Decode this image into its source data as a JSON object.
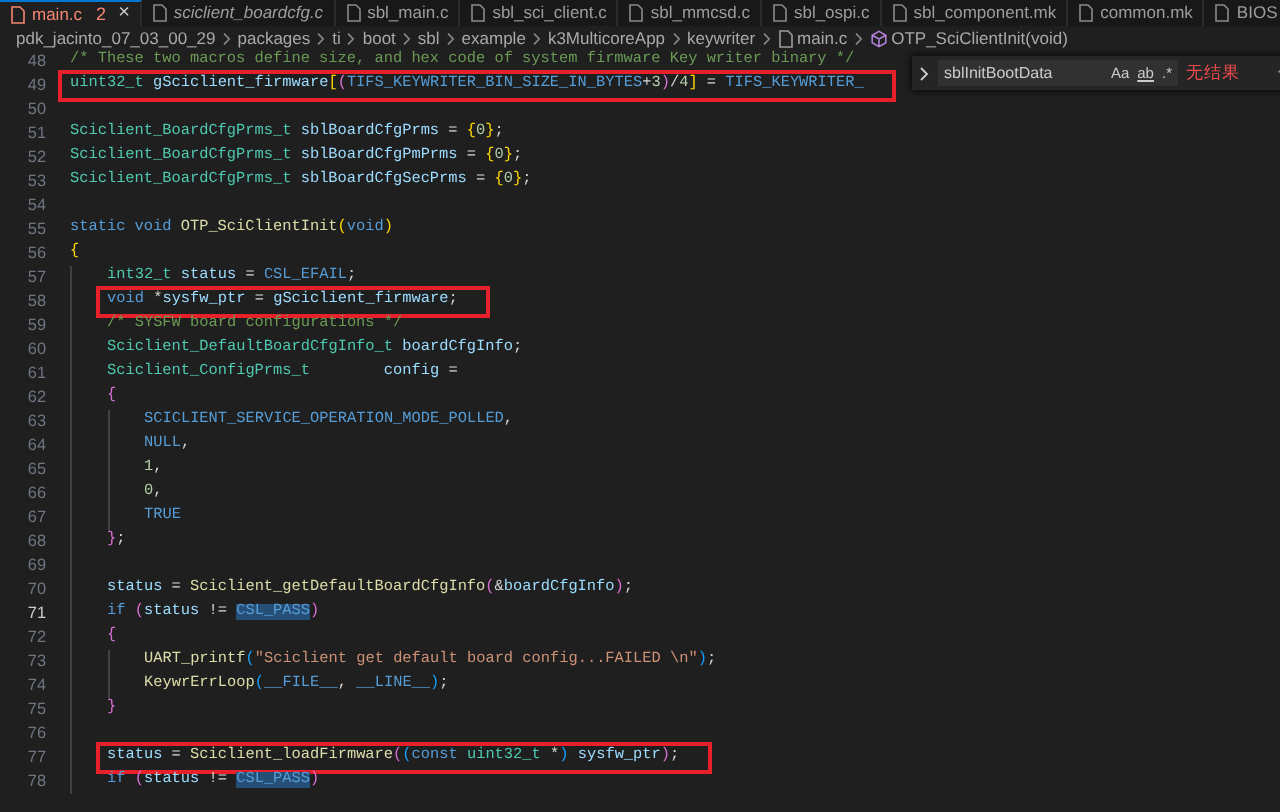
{
  "tabs": [
    {
      "label": "main.c",
      "badge": "2",
      "close": "×",
      "selected": true,
      "preview": false
    },
    {
      "label": "sciclient_boardcfg.c",
      "selected": false,
      "preview": true
    },
    {
      "label": "sbl_main.c",
      "selected": false,
      "preview": false
    },
    {
      "label": "sbl_sci_client.c",
      "selected": false,
      "preview": false
    },
    {
      "label": "sbl_mmcsd.c",
      "selected": false,
      "preview": false
    },
    {
      "label": "sbl_ospi.c",
      "selected": false,
      "preview": false
    },
    {
      "label": "sbl_component.mk",
      "selected": false,
      "preview": false
    },
    {
      "label": "common.mk",
      "selected": false,
      "preview": false
    },
    {
      "label": "BIOS",
      "selected": false,
      "preview": false
    }
  ],
  "breadcrumb": [
    {
      "label": "pdk_jacinto_07_03_00_29",
      "kind": "folder"
    },
    {
      "label": "packages",
      "kind": "folder"
    },
    {
      "label": "ti",
      "kind": "folder"
    },
    {
      "label": "boot",
      "kind": "folder"
    },
    {
      "label": "sbl",
      "kind": "folder"
    },
    {
      "label": "example",
      "kind": "folder"
    },
    {
      "label": "k3MulticoreApp",
      "kind": "folder"
    },
    {
      "label": "keywriter",
      "kind": "folder"
    },
    {
      "label": "main.c",
      "kind": "file"
    },
    {
      "label": "OTP_SciClientInit(void)",
      "kind": "function"
    }
  ],
  "find_widget": {
    "value": "sblInitBootData",
    "options": [
      "Aa",
      "ab",
      ".*"
    ],
    "result": "无结果"
  },
  "code": [
    {
      "number": "48",
      "tokens": [
        {
          "text": "/* These two macros define size, and hex code of system firmware Key writer binary */",
          "kind": "comment"
        }
      ]
    },
    {
      "number": "49",
      "boxed": true,
      "tokens": [
        {
          "text": "uint32_t ",
          "kind": "type"
        },
        {
          "text": "gSciclient_firmware",
          "kind": "var"
        },
        {
          "text": "[",
          "kind": "bracket1"
        },
        {
          "text": "(",
          "kind": "bracket2"
        },
        {
          "text": "TIFS_KEYWRITER_BIN_SIZE_IN_BYTES",
          "kind": "macro"
        },
        {
          "text": "+",
          "kind": "plain"
        },
        {
          "text": "3",
          "kind": "number"
        },
        {
          "text": ")",
          "kind": "bracket2"
        },
        {
          "text": "/",
          "kind": "plain"
        },
        {
          "text": "4",
          "kind": "number"
        },
        {
          "text": "]",
          "kind": "bracket1"
        },
        {
          "text": " = ",
          "kind": "plain"
        },
        {
          "text": "TIFS_KEYWRITER_",
          "kind": "macro"
        }
      ]
    },
    {
      "number": "50"
    },
    {
      "number": "51",
      "tokens": [
        {
          "text": "Sciclient_BoardCfgPrms_t ",
          "kind": "type"
        },
        {
          "text": "sblBoardCfgPrms",
          "kind": "var"
        },
        {
          "text": " = ",
          "kind": "plain"
        },
        {
          "text": "{",
          "kind": "bracket1"
        },
        {
          "text": "0",
          "kind": "number"
        },
        {
          "text": "}",
          "kind": "bracket1"
        },
        {
          "text": ";",
          "kind": "plain"
        }
      ]
    },
    {
      "number": "52",
      "tokens": [
        {
          "text": "Sciclient_BoardCfgPrms_t ",
          "kind": "type"
        },
        {
          "text": "sblBoardCfgPmPrms",
          "kind": "var"
        },
        {
          "text": " = ",
          "kind": "plain"
        },
        {
          "text": "{",
          "kind": "bracket1"
        },
        {
          "text": "0",
          "kind": "number"
        },
        {
          "text": "}",
          "kind": "bracket1"
        },
        {
          "text": ";",
          "kind": "plain"
        }
      ]
    },
    {
      "number": "53",
      "tokens": [
        {
          "text": "Sciclient_BoardCfgPrms_t ",
          "kind": "type"
        },
        {
          "text": "sblBoardCfgSecPrms",
          "kind": "var"
        },
        {
          "text": " = ",
          "kind": "plain"
        },
        {
          "text": "{",
          "kind": "bracket1"
        },
        {
          "text": "0",
          "kind": "number"
        },
        {
          "text": "}",
          "kind": "bracket1"
        },
        {
          "text": ";",
          "kind": "plain"
        }
      ]
    },
    {
      "number": "54"
    },
    {
      "number": "55",
      "tokens": [
        {
          "text": "static void ",
          "kind": "keyword"
        },
        {
          "text": "OTP_SciClientInit",
          "kind": "func"
        },
        {
          "text": "(",
          "kind": "bracket1"
        },
        {
          "text": "void",
          "kind": "keyword"
        },
        {
          "text": ")",
          "kind": "bracket1"
        }
      ]
    },
    {
      "number": "56",
      "tokens": [
        {
          "text": "{",
          "kind": "bracket1"
        }
      ],
      "children": [
        {
          "number": "57",
          "tokens": [
            {
              "text": "int32_t ",
              "kind": "type"
            },
            {
              "text": "status",
              "kind": "var"
            },
            {
              "text": " = ",
              "kind": "plain"
            },
            {
              "text": "CSL_EFAIL",
              "kind": "macro"
            },
            {
              "text": ";",
              "kind": "plain"
            }
          ]
        },
        {
          "number": "58",
          "boxed": true,
          "tokens": [
            {
              "text": "void ",
              "kind": "keyword"
            },
            {
              "text": "*",
              "kind": "plain"
            },
            {
              "text": "sysfw_ptr",
              "kind": "var"
            },
            {
              "text": " = ",
              "kind": "plain"
            },
            {
              "text": "gSciclient_firmware",
              "kind": "var"
            },
            {
              "text": ";",
              "kind": "plain"
            }
          ]
        },
        {
          "number": "59",
          "tokens": [
            {
              "text": "/* SYSFW board configurations */",
              "kind": "comment"
            }
          ]
        },
        {
          "number": "60",
          "tokens": [
            {
              "text": "Sciclient_DefaultBoardCfgInfo_t ",
              "kind": "type"
            },
            {
              "text": "boardCfgInfo",
              "kind": "var"
            },
            {
              "text": ";",
              "kind": "plain"
            }
          ]
        },
        {
          "number": "61",
          "tokens": [
            {
              "text": "Sciclient_ConfigPrms_t        ",
              "kind": "type"
            },
            {
              "text": "config",
              "kind": "var"
            },
            {
              "text": " =",
              "kind": "plain"
            }
          ]
        },
        {
          "number": "62",
          "tokens": [
            {
              "text": "{",
              "kind": "bracket2"
            }
          ],
          "children": [
            {
              "number": "63",
              "tokens": [
                {
                  "text": "SCICLIENT_SERVICE_OPERATION_MODE_POLLED",
                  "kind": "macro"
                },
                {
                  "text": ",",
                  "kind": "plain"
                }
              ]
            },
            {
              "number": "64",
              "tokens": [
                {
                  "text": "NULL",
                  "kind": "macro"
                },
                {
                  "text": ",",
                  "kind": "plain"
                }
              ]
            },
            {
              "number": "65",
              "tokens": [
                {
                  "text": "1",
                  "kind": "number"
                },
                {
                  "text": ",",
                  "kind": "plain"
                }
              ]
            },
            {
              "number": "66",
              "tokens": [
                {
                  "text": "0",
                  "kind": "number"
                },
                {
                  "text": ",",
                  "kind": "plain"
                }
              ]
            },
            {
              "number": "67",
              "tokens": [
                {
                  "text": "TRUE",
                  "kind": "macro"
                }
              ]
            }
          ]
        },
        {
          "number": "68",
          "tokens": [
            {
              "text": "}",
              "kind": "bracket2"
            },
            {
              "text": ";",
              "kind": "plain"
            }
          ]
        },
        {
          "number": "69"
        },
        {
          "number": "70",
          "tokens": [
            {
              "text": "status",
              "kind": "var"
            },
            {
              "text": " = ",
              "kind": "plain"
            },
            {
              "text": "Sciclient_getDefaultBoardCfgInfo",
              "kind": "func"
            },
            {
              "text": "(",
              "kind": "bracket2"
            },
            {
              "text": "&",
              "kind": "plain"
            },
            {
              "text": "boardCfgInfo",
              "kind": "var"
            },
            {
              "text": ")",
              "kind": "bracket2"
            },
            {
              "text": ";",
              "kind": "plain"
            }
          ]
        },
        {
          "number": "71",
          "current": true,
          "tokens": [
            {
              "text": "if ",
              "kind": "keyword"
            },
            {
              "text": "(",
              "kind": "bracket2"
            },
            {
              "text": "status",
              "kind": "var"
            },
            {
              "text": " != ",
              "kind": "plain"
            },
            {
              "text": "CSL_PASS",
              "kind": "match"
            },
            {
              "text": ")",
              "kind": "bracket2"
            }
          ]
        },
        {
          "number": "72",
          "tokens": [
            {
              "text": "{",
              "kind": "bracket2"
            }
          ],
          "children": [
            {
              "number": "73",
              "tokens": [
                {
                  "text": "UART_printf",
                  "kind": "func"
                },
                {
                  "text": "(",
                  "kind": "bracket3"
                },
                {
                  "text": "\"Sciclient get default board config...FAILED \\n\"",
                  "kind": "string"
                },
                {
                  "text": ")",
                  "kind": "bracket3"
                },
                {
                  "text": ";",
                  "kind": "plain"
                }
              ]
            },
            {
              "number": "74",
              "tokens": [
                {
                  "text": "KeywrErrLoop",
                  "kind": "func"
                },
                {
                  "text": "(",
                  "kind": "bracket3"
                },
                {
                  "text": "__FILE__",
                  "kind": "macro"
                },
                {
                  "text": ", ",
                  "kind": "plain"
                },
                {
                  "text": "__LINE__",
                  "kind": "macro"
                },
                {
                  "text": ")",
                  "kind": "bracket3"
                },
                {
                  "text": ";",
                  "kind": "plain"
                }
              ]
            }
          ]
        },
        {
          "number": "75",
          "tokens": [
            {
              "text": "}",
              "kind": "bracket2"
            }
          ]
        },
        {
          "number": "76"
        },
        {
          "number": "77",
          "boxed": true,
          "tokens": [
            {
              "text": "status",
              "kind": "var"
            },
            {
              "text": " = ",
              "kind": "plain"
            },
            {
              "text": "Sciclient_loadFirmware",
              "kind": "func"
            },
            {
              "text": "(",
              "kind": "bracket2"
            },
            {
              "text": "(",
              "kind": "bracket3"
            },
            {
              "text": "const ",
              "kind": "keyword"
            },
            {
              "text": "uint32_t ",
              "kind": "type"
            },
            {
              "text": "*",
              "kind": "plain"
            },
            {
              "text": ")",
              "kind": "bracket3"
            },
            {
              "text": " sysfw_ptr",
              "kind": "var"
            },
            {
              "text": ")",
              "kind": "bracket2"
            },
            {
              "text": ";",
              "kind": "plain"
            }
          ]
        },
        {
          "number": "78",
          "tokens": [
            {
              "text": "if ",
              "kind": "keyword"
            },
            {
              "text": "(",
              "kind": "bracket2"
            },
            {
              "text": "status",
              "kind": "var"
            },
            {
              "text": " != ",
              "kind": "plain"
            },
            {
              "text": "CSL_PASS",
              "kind": "match"
            },
            {
              "text": ")",
              "kind": "bracket2"
            }
          ]
        }
      ]
    }
  ]
}
